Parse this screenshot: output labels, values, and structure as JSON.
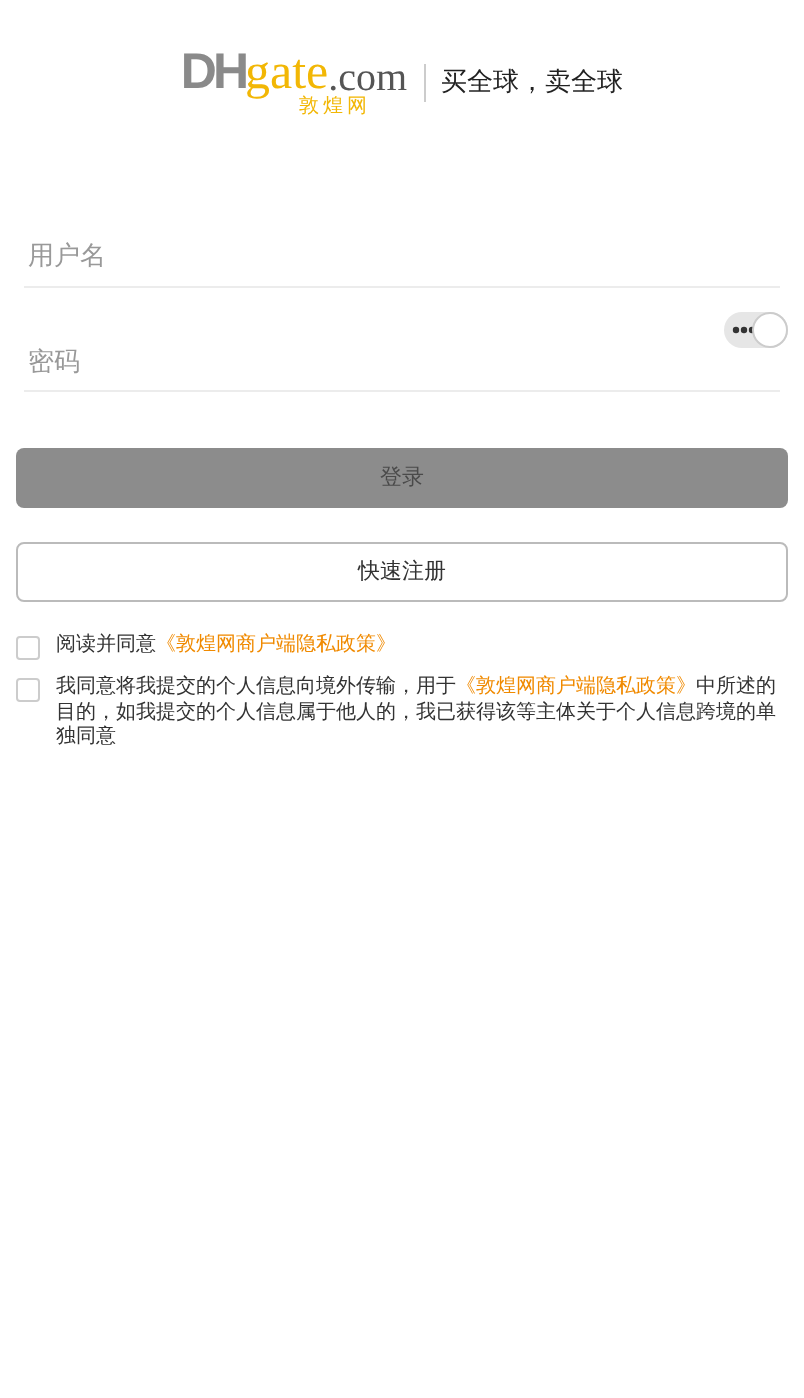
{
  "logo": {
    "dh": "DH",
    "gate": "gate",
    "com": ".com",
    "sub": "敦煌网"
  },
  "slogan": "买全球，卖全球",
  "username": {
    "placeholder": "用户名"
  },
  "password": {
    "placeholder": "密码",
    "show_toggle_on": true
  },
  "login_button": {
    "label": "登录",
    "disabled": true
  },
  "register_button": {
    "label": "快速注册"
  },
  "agreements": [
    {
      "checked": false,
      "text": "阅读并同意",
      "link": "《敦煌网商户端隐私政策》"
    },
    {
      "checked": false,
      "text": "我同意将我提交的个人信息向境外传输，用于",
      "link": "《敦煌网商户端隐私政策》",
      "after": "中所述的目的，如我提交的个人信息属于他人的，我已获得该等主体关于个人信息跨境的单独同意"
    }
  ]
}
